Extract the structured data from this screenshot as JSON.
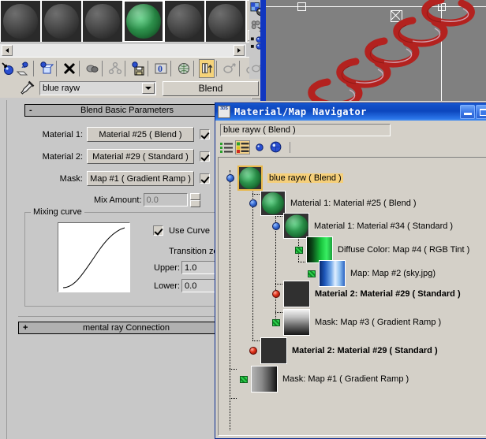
{
  "material_editor": {
    "slots": [
      {
        "name": "slot-1",
        "style": "grey",
        "selected": false
      },
      {
        "name": "slot-2",
        "style": "grey",
        "selected": false
      },
      {
        "name": "slot-3",
        "style": "grey",
        "selected": false
      },
      {
        "name": "slot-4",
        "style": "green",
        "selected": true
      },
      {
        "name": "slot-5",
        "style": "grey",
        "selected": false
      },
      {
        "name": "slot-6",
        "style": "grey",
        "selected": false
      }
    ],
    "toolbar": [
      {
        "name": "get-material-icon",
        "glyph": "get"
      },
      {
        "name": "put-material-to-scene-icon",
        "glyph": "put"
      },
      {
        "name": "assign-material-to-selection-icon",
        "glyph": "assign"
      },
      {
        "name": "reset-map-material-icon",
        "glyph": "reset"
      },
      {
        "name": "make-material-copy-icon",
        "glyph": "copy"
      },
      {
        "name": "make-unique-icon",
        "glyph": "unique"
      },
      {
        "name": "put-to-library-icon",
        "glyph": "library"
      },
      {
        "name": "material-effects-channel-icon",
        "glyph": "channel"
      },
      {
        "name": "show-map-in-viewport-icon",
        "glyph": "showmap"
      },
      {
        "name": "show-end-result-icon",
        "glyph": "endresult"
      },
      {
        "name": "go-to-parent-icon",
        "glyph": "goparent"
      },
      {
        "name": "go-forward-to-sibling-icon",
        "glyph": "gosibling"
      }
    ],
    "material_name": {
      "label": "material-name",
      "value": "blue rayw",
      "placeholder": "material name"
    },
    "material_type_button": "Blend",
    "picker_icon": "eyedropper-icon"
  },
  "blend_params": {
    "rollout_title": "Blend Basic Parameters",
    "rollout_state": "-",
    "rows": [
      {
        "label": "Material 1:",
        "value": "Material #25  ( Blend )",
        "checked": true,
        "radio": false
      },
      {
        "label": "Material 2:",
        "value": "Material #29  ( Standard )",
        "checked": true,
        "radio": false
      },
      {
        "label": "Mask:",
        "value": "Map #1  ( Gradient Ramp )",
        "checked": true,
        "radio": true
      }
    ],
    "mix_amount_label": "Mix Amount:",
    "mix_amount_value": "0.0",
    "mixing_curve_title": "Mixing curve",
    "use_curve_label": "Use Curve",
    "use_curve_checked": true,
    "transition_zone_label": "Transition zor",
    "upper_label": "Upper:",
    "upper_value": "1.0",
    "lower_label": "Lower:",
    "lower_value": "0.0",
    "mental_ray_title": "mental ray Connection",
    "mental_ray_state": "+"
  },
  "viewport": {
    "name": "perspective-viewport",
    "object": "red-spiral-helix",
    "background_color": "#808080",
    "object_color": "#b3221f"
  },
  "navigator": {
    "title": "Material/Map Navigator",
    "app_icon": "3ds-max-icon",
    "window_buttons": [
      {
        "name": "minimize-button",
        "glyph": "minimize"
      },
      {
        "name": "maximize-button",
        "glyph": "maximize"
      }
    ],
    "path_value": "blue rayw  ( Blend )",
    "toolbar": [
      {
        "name": "view-list-icon",
        "active": false
      },
      {
        "name": "view-list-icons-icon",
        "active": true
      },
      {
        "name": "view-small-icons-icon",
        "active": false
      },
      {
        "name": "view-large-icons-icon",
        "active": false
      }
    ],
    "tree": [
      {
        "name": "node-blue-rayw",
        "label": "blue rayw  ( Blend )",
        "depth": 0,
        "marker": "blue-sphere",
        "thumb": "green-ball",
        "selected": true,
        "bold": false
      },
      {
        "name": "node-material1-25",
        "label": "Material 1: Material #25  ( Blend )",
        "depth": 1,
        "marker": "blue-sphere",
        "thumb": "green-ball",
        "selected": false,
        "bold": false
      },
      {
        "name": "node-material1-34",
        "label": "Material 1: Material #34  ( Standard )",
        "depth": 2,
        "marker": "blue-sphere",
        "thumb": "green-ball",
        "selected": false,
        "bold": false
      },
      {
        "name": "node-diffuse-map4",
        "label": "Diffuse Color: Map #4  ( RGB Tint )",
        "depth": 3,
        "marker": "green-square",
        "thumb": "rgb-tint",
        "selected": false,
        "bold": false
      },
      {
        "name": "node-map2-sky",
        "label": "Map: Map #2 (sky.jpg)",
        "depth": 4,
        "marker": "green-square",
        "thumb": "sky",
        "selected": false,
        "bold": false
      },
      {
        "name": "node-material2-29-inner",
        "label": "Material 2: Material #29  ( Standard )",
        "depth": 2,
        "marker": "red-sphere",
        "thumb": "dark",
        "selected": false,
        "bold": true
      },
      {
        "name": "node-mask-map3",
        "label": "Mask: Map #3  ( Gradient Ramp )",
        "depth": 2,
        "marker": "green-square",
        "thumb": "ramp-v",
        "selected": false,
        "bold": false
      },
      {
        "name": "node-material2-29-outer",
        "label": "Material 2: Material #29  ( Standard )",
        "depth": 1,
        "marker": "red-sphere",
        "thumb": "dark",
        "selected": false,
        "bold": true
      },
      {
        "name": "node-mask-map1",
        "label": "Mask: Map #1  ( Gradient Ramp )",
        "depth": 1,
        "marker": "green-square",
        "thumb": "ramp-h",
        "selected": false,
        "bold": false
      }
    ]
  },
  "colors": {
    "titlebar_blue": "#0c46bd",
    "panel_grey": "#c8c8c8",
    "selection_gold": "#f5cf7a",
    "viewport_grey": "#808080"
  }
}
